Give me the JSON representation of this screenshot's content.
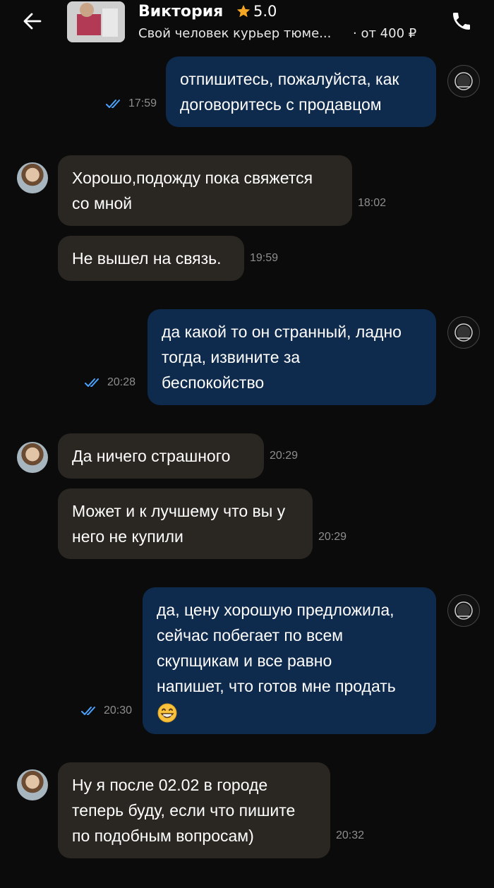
{
  "header": {
    "back_icon": "arrow-left-icon",
    "seller_name": "Виктория",
    "rating": "5.0",
    "rating_icon": "star-icon",
    "listing_title": "Свой человек курьер тюме...",
    "listing_price": "· от 400 ₽",
    "call_icon": "phone-icon"
  },
  "colors": {
    "background": "#0b0b0b",
    "incoming_bubble": "#2a2722",
    "outgoing_bubble": "#0e2a4d",
    "read_ticks": "#4aa3ff",
    "star": "#f5a623"
  },
  "messages": [
    {
      "direction": "out",
      "text_lines": [
        "отпишитесь, пожалуйста, как",
        "договоритесь с продавцом"
      ],
      "time": "17:59",
      "read": true
    },
    {
      "direction": "in",
      "text_lines": [
        "Хорошо,подожду пока свяжется",
        "со мной"
      ],
      "time": "18:02"
    },
    {
      "direction": "in",
      "text_lines": [
        "Не вышел на связь."
      ],
      "time": "19:59"
    },
    {
      "direction": "out",
      "text_lines": [
        "да какой то он странный, ладно",
        "тогда, извините за",
        "беспокойство"
      ],
      "time": "20:28",
      "read": true
    },
    {
      "direction": "in",
      "text_lines": [
        "Да ничего страшного"
      ],
      "time": "20:29"
    },
    {
      "direction": "in",
      "text_lines": [
        "Может и к лучшему что вы у",
        "него не купили"
      ],
      "time": "20:29"
    },
    {
      "direction": "out",
      "text_lines": [
        "да, цену хорошую предложила,",
        "сейчас побегает по всем",
        "скупщикам и все равно",
        "напишет, что готов мне продать"
      ],
      "emoji": "grinning-face-emoji",
      "time": "20:30",
      "read": true
    },
    {
      "direction": "in",
      "text_lines": [
        "Ну я после 02.02 в городе",
        "теперь буду, если что пишите",
        "по подобным вопросам)"
      ],
      "time": "20:32"
    }
  ]
}
